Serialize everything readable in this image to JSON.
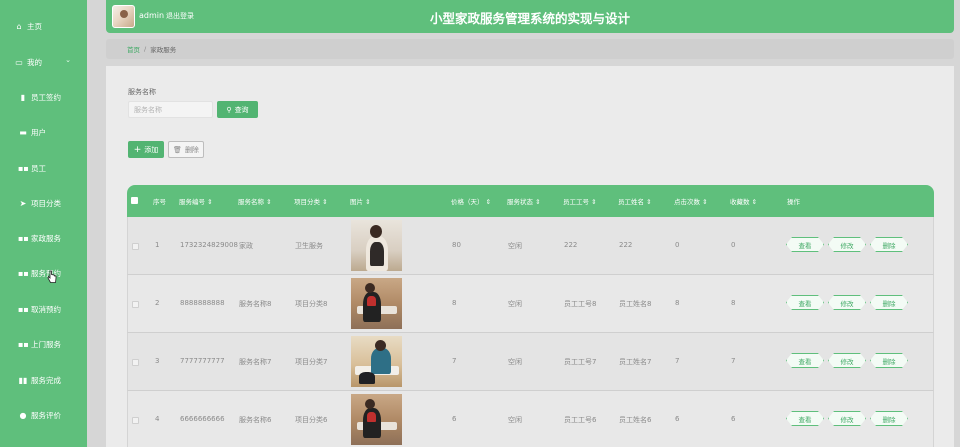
{
  "sidebar": {
    "items": [
      {
        "label": "主页",
        "icon": "home-icon"
      },
      {
        "label": "我的",
        "icon": "window-icon"
      },
      {
        "label": "员工签约",
        "icon": "clipboard-icon"
      },
      {
        "label": "用户",
        "icon": "briefcase-icon"
      },
      {
        "label": "员工",
        "icon": "grid-icon"
      },
      {
        "label": "项目分类",
        "icon": "send-icon"
      },
      {
        "label": "家政服务",
        "icon": "grid-icon"
      },
      {
        "label": "服务预约",
        "icon": "grid-icon"
      },
      {
        "label": "取消预约",
        "icon": "grid-icon"
      },
      {
        "label": "上门服务",
        "icon": "grid-icon"
      },
      {
        "label": "服务完成",
        "icon": "bar-chart-icon"
      },
      {
        "label": "服务评价",
        "icon": "user-icon"
      }
    ]
  },
  "header": {
    "user": "admin",
    "logout": "退出登录",
    "title": "小型家政服务管理系统的实现与设计"
  },
  "breadcrumb": {
    "home": "首页",
    "separator": "/",
    "current": "家政服务"
  },
  "search": {
    "label": "服务名称",
    "placeholder": "服务名称",
    "query_button": "查询"
  },
  "toolbar": {
    "add": "添加",
    "delete": "删除"
  },
  "table": {
    "headers": {
      "index": "序号",
      "code": "服务编号",
      "name": "服务名称",
      "category": "项目分类",
      "image": "图片",
      "price": "价格（天）",
      "status": "服务状态",
      "emp_no": "员工工号",
      "emp_name": "员工姓名",
      "clicks": "点击次数",
      "favorites": "收藏数",
      "actions": "操作"
    },
    "rows": [
      {
        "index": "1",
        "code": "1732324829008",
        "name": "家政",
        "category": "卫生服务",
        "price": "80",
        "status": "空闲",
        "emp_no": "222",
        "emp_name": "222",
        "clicks": "0",
        "favorites": "0"
      },
      {
        "index": "2",
        "code": "8888888888",
        "name": "服务名称8",
        "category": "项目分类8",
        "price": "8",
        "status": "空闲",
        "emp_no": "员工工号8",
        "emp_name": "员工姓名8",
        "clicks": "8",
        "favorites": "8"
      },
      {
        "index": "3",
        "code": "7777777777",
        "name": "服务名称7",
        "category": "项目分类7",
        "price": "7",
        "status": "空闲",
        "emp_no": "员工工号7",
        "emp_name": "员工姓名7",
        "clicks": "7",
        "favorites": "7"
      },
      {
        "index": "4",
        "code": "6666666666",
        "name": "服务名称6",
        "category": "项目分类6",
        "price": "6",
        "status": "空闲",
        "emp_no": "员工工号6",
        "emp_name": "员工姓名6",
        "clicks": "6",
        "favorites": "6"
      }
    ],
    "actions": {
      "view": "查看",
      "edit": "修改",
      "delete": "删除"
    }
  },
  "colors": {
    "primary": "#5fbf7c",
    "button": "#52b472",
    "link": "#3fa964"
  }
}
